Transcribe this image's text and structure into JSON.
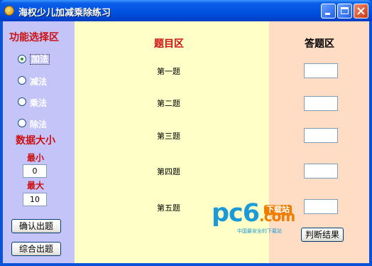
{
  "window": {
    "title": "海权少儿加减乘除练习",
    "colors": {
      "titlebar": "#0a5fe8",
      "left_panel": "#c4c4f8",
      "mid_panel": "#ffffc8",
      "right_panel": "#ffdcc4",
      "heading_red": "#cc1010"
    }
  },
  "left": {
    "function_heading": "功能选择区",
    "radios": [
      {
        "label": "加法",
        "selected": true
      },
      {
        "label": "减法",
        "selected": false
      },
      {
        "label": "乘法",
        "selected": false
      },
      {
        "label": "除法",
        "selected": false
      }
    ],
    "size_heading": "数据大小",
    "min_label": "最小",
    "min_value": "0",
    "max_label": "最大",
    "max_value": "10",
    "confirm_button": "确认出题",
    "mixed_button": "综合出题"
  },
  "middle": {
    "heading": "题目区",
    "questions": [
      "第一题",
      "第二题",
      "第三题",
      "第四题",
      "第五题"
    ]
  },
  "right": {
    "heading": "答题区",
    "answers": [
      "",
      "",
      "",
      "",
      ""
    ],
    "judge_button": "判断结果"
  },
  "watermark": {
    "logo_main": "pc6",
    "logo_domain": ".com",
    "tag": "下载站",
    "slogan": "中国最安全的下载站"
  }
}
